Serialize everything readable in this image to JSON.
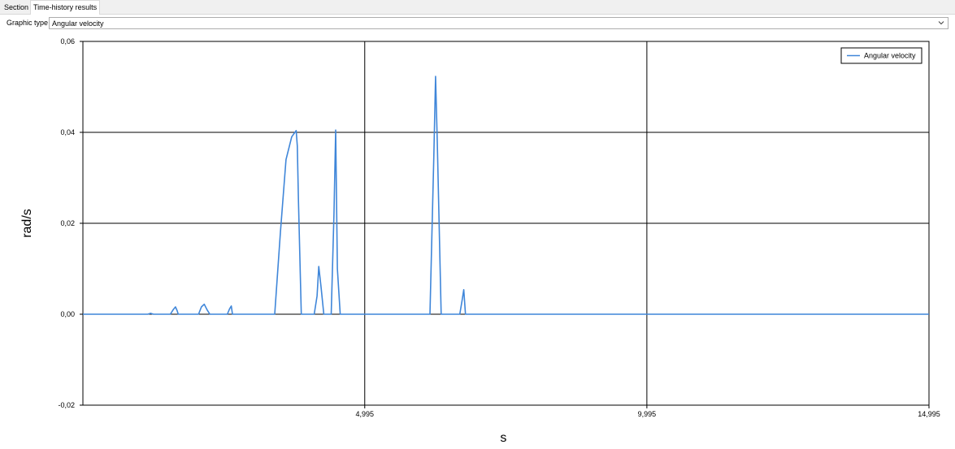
{
  "tabs": [
    {
      "label": "Section",
      "active": false
    },
    {
      "label": "Time-history results",
      "active": true
    }
  ],
  "graphic_type": {
    "label": "Graphic type",
    "selected": "Angular velocity"
  },
  "chart_data": {
    "type": "line",
    "title": "",
    "xlabel": "s",
    "ylabel": "rad/s",
    "xlim": [
      0,
      14.995
    ],
    "ylim": [
      -0.02,
      0.06
    ],
    "x_ticks": [
      4.995,
      9.995,
      14.995
    ],
    "x_tick_labels": [
      "4,995",
      "9,995",
      "14,995"
    ],
    "y_ticks": [
      -0.02,
      0,
      0.02,
      0.04,
      0.06
    ],
    "y_tick_labels": [
      "-0,02",
      "0,00",
      "0,02",
      "0,04",
      "0,06"
    ],
    "grid": true,
    "legend": "top-right",
    "series": [
      {
        "name": "Angular velocity",
        "color": "#3f86d9",
        "x": [
          0,
          1.15,
          1.2,
          1.25,
          1.55,
          1.6,
          1.64,
          1.67,
          1.69,
          2.05,
          2.1,
          2.15,
          2.2,
          2.25,
          2.56,
          2.6,
          2.63,
          2.65,
          3.4,
          3.5,
          3.6,
          3.7,
          3.78,
          3.8,
          3.82,
          3.87,
          3.95,
          4.1,
          4.15,
          4.18,
          4.22,
          4.27,
          4.4,
          4.45,
          4.48,
          4.51,
          4.56,
          6.0,
          6.15,
          6.22,
          6.25,
          6.28,
          6.35,
          6.45,
          6.68,
          6.72,
          6.75,
          6.78,
          14.995
        ],
        "y": [
          0,
          0,
          0.0002,
          0,
          0,
          0.001,
          0.0016,
          0.0008,
          0,
          0,
          0.0016,
          0.0022,
          0.001,
          0,
          0,
          0.0012,
          0.0018,
          0,
          0,
          0.018,
          0.034,
          0.039,
          0.0404,
          0.037,
          0.025,
          0,
          0,
          0,
          0.004,
          0.0105,
          0.006,
          0,
          0,
          0.022,
          0.0405,
          0.01,
          0,
          0,
          0,
          0.035,
          0.0523,
          0.038,
          0,
          0,
          0,
          0.003,
          0.0054,
          0,
          0
        ]
      }
    ]
  }
}
